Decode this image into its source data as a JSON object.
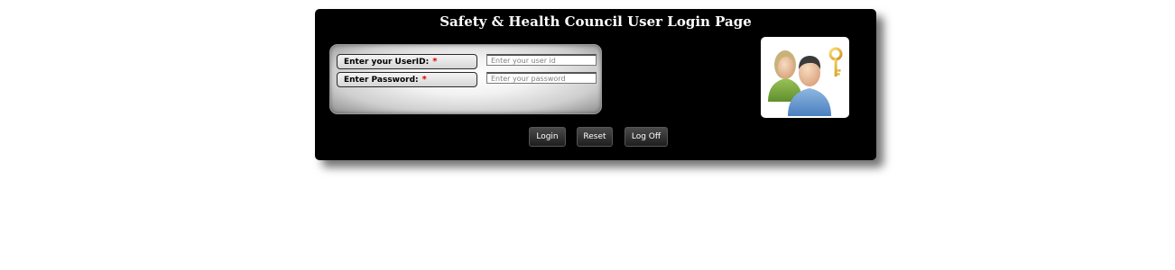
{
  "login": {
    "title": "Safety & Health Council User Login Page",
    "userid_label": "Enter your UserID:",
    "password_label": "Enter Password:",
    "required_marker": "*",
    "userid_value": "",
    "userid_placeholder": "Enter your user id",
    "password_value": "",
    "password_placeholder": "Enter your password"
  },
  "buttons": {
    "login_label": "Login",
    "reset_label": "Reset",
    "logoff_label": "Log Off"
  },
  "icons": {
    "users_key_icon": "users-with-key-icon"
  },
  "colors": {
    "panel_background": "#000000",
    "required_marker": "#e00000",
    "button_background": "#2a2a2a"
  }
}
